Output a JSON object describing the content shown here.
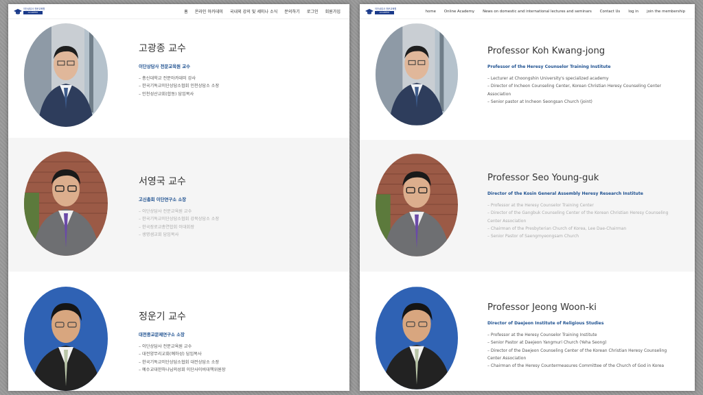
{
  "ko": {
    "logo": {
      "top": "이단상담사 전문교육원",
      "bar": "ACADEMY"
    },
    "nav": [
      "홈",
      "온라인 아카데미",
      "국내외 강의 및 세미나 소식",
      "문의하기",
      "로그인",
      "회원가입"
    ],
    "professors": [
      {
        "name": "고광종 교수",
        "title": "이단상담사 전문교육원 교수",
        "duties": [
          "– 총신대학교 전문아카데미 강사",
          "– 한국기독교이단상담소협회 인천상담소 소장",
          "– 인천성산교회(합동) 담임목사"
        ]
      },
      {
        "name": "서영국 교수",
        "title": "고신총회 이단연구소 소장",
        "duties": [
          "– 이단상담사 전문교육원 교수",
          "– 한국기독교이단상담소협회 강북상담소 소장",
          "– 한국장로교총연합회 이대회장",
          "– 생명샘교회 담임목사"
        ]
      },
      {
        "name": "정운기 교수",
        "title": "대전종교문제연구소 소장",
        "duties": [
          "– 이단상담사 전문교육원 교수",
          "– 대전양무리교회(예하성) 담임목사",
          "– 한국기독교이단상담소협회 대전상담소 소장",
          "– 예수교대한하나님의성회 이단사이비대책위원장"
        ]
      }
    ]
  },
  "en": {
    "logo": {
      "top": "이단상담사 전문교육원",
      "bar": "ACADEMY"
    },
    "nav": [
      "home",
      "Online Academy",
      "News on domestic and international lectures and seminars",
      "Contact Us",
      "log in",
      "join the membership"
    ],
    "professors": [
      {
        "name": "Professor Koh Kwang-jong",
        "title": "Professor of the Heresy Counselor Training Institute",
        "duties": [
          "– Lecturer at Choongshin University's specialized academy",
          "– Director of Incheon Counseling Center, Korean Christian Heresy Counseling Center",
          "Association",
          "– Senior pastor at Incheon Seongsan Church (joint)"
        ]
      },
      {
        "name": "Professor Seo Young-guk",
        "title": "Director of the Kosin General Assembly Heresy Research Institute",
        "duties": [
          "– Professor at the Heresy Counselor Training Center",
          "– Director of the Gangbuk Counseling Center of the Korean Christian Heresy Counseling",
          "Center Association",
          "– Chairman of the Presbyterian Church of Korea, Lee Dae-Chairman",
          "– Senior Pastor of Saengmyeongsam Church"
        ]
      },
      {
        "name": "Professor Jeong Woon-ki",
        "title": "Director of Daejeon Institute of Religious Studies",
        "duties": [
          "– Professor at the Heresy Counselor Training Institute",
          "– Senior Pastor at Daejeon Yangmuri Church (Yeha Seong)",
          "– Director of the Daejeon Counseling Center of the Korean Christian Heresy Counseling",
          "Center Association",
          "– Chairman of the Heresy Countermeasures Committee of the Church of God in Korea"
        ]
      }
    ]
  },
  "colors": {
    "title_blue": "#1c4f8f",
    "shade": "#f5f5f5"
  }
}
